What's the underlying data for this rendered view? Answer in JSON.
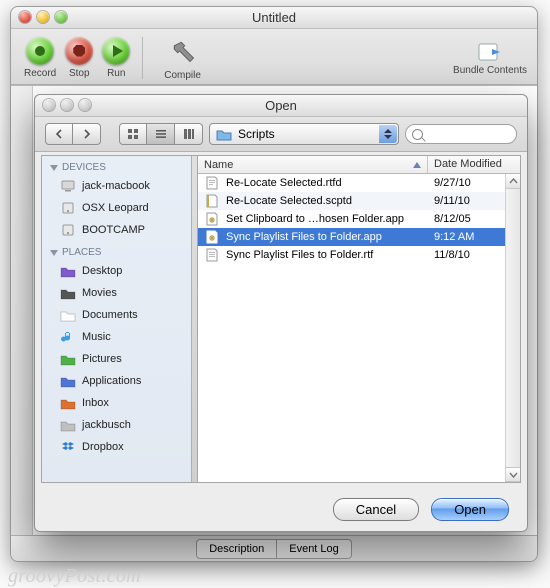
{
  "editor": {
    "title": "Untitled",
    "toolbar": {
      "record": "Record",
      "stop": "Stop",
      "run": "Run",
      "compile": "Compile",
      "bundle": "Bundle Contents"
    },
    "bottom_tabs": {
      "description": "Description",
      "event_log": "Event Log"
    }
  },
  "open_dialog": {
    "title": "Open",
    "folder_popup": "Scripts",
    "search_placeholder": "",
    "sidebar": {
      "groups": [
        {
          "label": "DEVICES",
          "items": [
            "jack-macbook",
            "OSX Leopard",
            "BOOTCAMP"
          ]
        },
        {
          "label": "PLACES",
          "items": [
            "Desktop",
            "Movies",
            "Documents",
            "Music",
            "Pictures",
            "Applications",
            "Inbox",
            "jackbusch",
            "Dropbox"
          ]
        }
      ]
    },
    "columns": {
      "name": "Name",
      "date": "Date Modified"
    },
    "files": [
      {
        "name": "Re-Locate Selected.rtfd",
        "date": "9/27/10",
        "icon": "rtfd",
        "selected": false
      },
      {
        "name": "Re-Locate Selected.scptd",
        "date": "9/11/10",
        "icon": "scptd",
        "selected": false
      },
      {
        "name": "Set Clipboard to …hosen Folder.app",
        "date": "8/12/05",
        "icon": "app",
        "selected": false
      },
      {
        "name": "Sync Playlist Files to Folder.app",
        "date": "9:12 AM",
        "icon": "app",
        "selected": true
      },
      {
        "name": "Sync Playlist Files to Folder.rtf",
        "date": "11/8/10",
        "icon": "rtf",
        "selected": false
      }
    ],
    "buttons": {
      "cancel": "Cancel",
      "open": "Open"
    }
  },
  "watermark": "groovyPost.com"
}
